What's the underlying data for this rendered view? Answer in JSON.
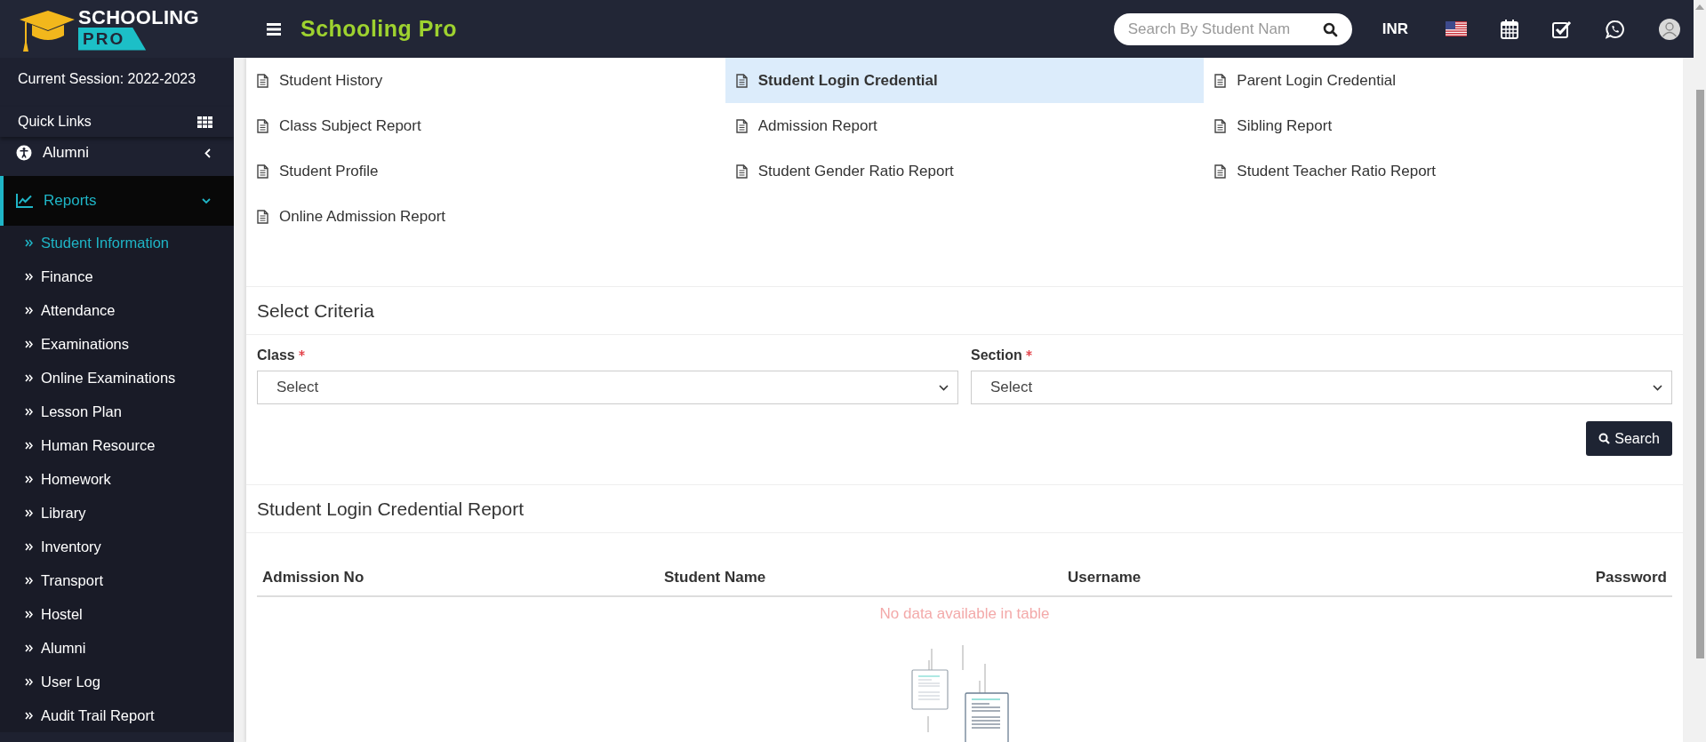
{
  "header": {
    "logo_top": "SCHOOLING",
    "logo_bottom": "PRO",
    "app_title": "Schooling Pro",
    "search": {
      "placeholder": "Search By Student Nam"
    },
    "currency": "INR"
  },
  "sidebar": {
    "session": "Current Session: 2022-2023",
    "quick_links": "Quick Links",
    "menu": [
      {
        "label": "Alumni",
        "expanded": false,
        "selected": false
      },
      {
        "label": "Reports",
        "expanded": true,
        "selected": true,
        "children": [
          {
            "label": "Student Information",
            "selected": true
          },
          {
            "label": "Finance",
            "selected": false
          },
          {
            "label": "Attendance",
            "selected": false
          },
          {
            "label": "Examinations",
            "selected": false
          },
          {
            "label": "Online Examinations",
            "selected": false
          },
          {
            "label": "Lesson Plan",
            "selected": false
          },
          {
            "label": "Human Resource",
            "selected": false
          },
          {
            "label": "Homework",
            "selected": false
          },
          {
            "label": "Library",
            "selected": false
          },
          {
            "label": "Inventory",
            "selected": false
          },
          {
            "label": "Transport",
            "selected": false
          },
          {
            "label": "Hostel",
            "selected": false
          },
          {
            "label": "Alumni",
            "selected": false
          },
          {
            "label": "User Log",
            "selected": false
          },
          {
            "label": "Audit Trail Report",
            "selected": false
          }
        ]
      }
    ]
  },
  "report_links": [
    {
      "label": "Student History",
      "selected": false
    },
    {
      "label": "Student Login Credential",
      "selected": true
    },
    {
      "label": "Parent Login Credential",
      "selected": false
    },
    {
      "label": "Class Subject Report",
      "selected": false
    },
    {
      "label": "Admission Report",
      "selected": false
    },
    {
      "label": "Sibling Report",
      "selected": false
    },
    {
      "label": "Student Profile",
      "selected": false
    },
    {
      "label": "Student Gender Ratio Report",
      "selected": false
    },
    {
      "label": "Student Teacher Ratio Report",
      "selected": false
    },
    {
      "label": "Online Admission Report",
      "selected": false
    }
  ],
  "criteria": {
    "title": "Select Criteria",
    "fields": [
      {
        "label": "Class",
        "required": true,
        "value": "Select"
      },
      {
        "label": "Section",
        "required": true,
        "value": "Select"
      }
    ],
    "button": "Search"
  },
  "report": {
    "title": "Student Login Credential Report",
    "columns": [
      "Admission No",
      "Student Name",
      "Username",
      "Password"
    ],
    "empty_text": "No data available in table"
  }
}
